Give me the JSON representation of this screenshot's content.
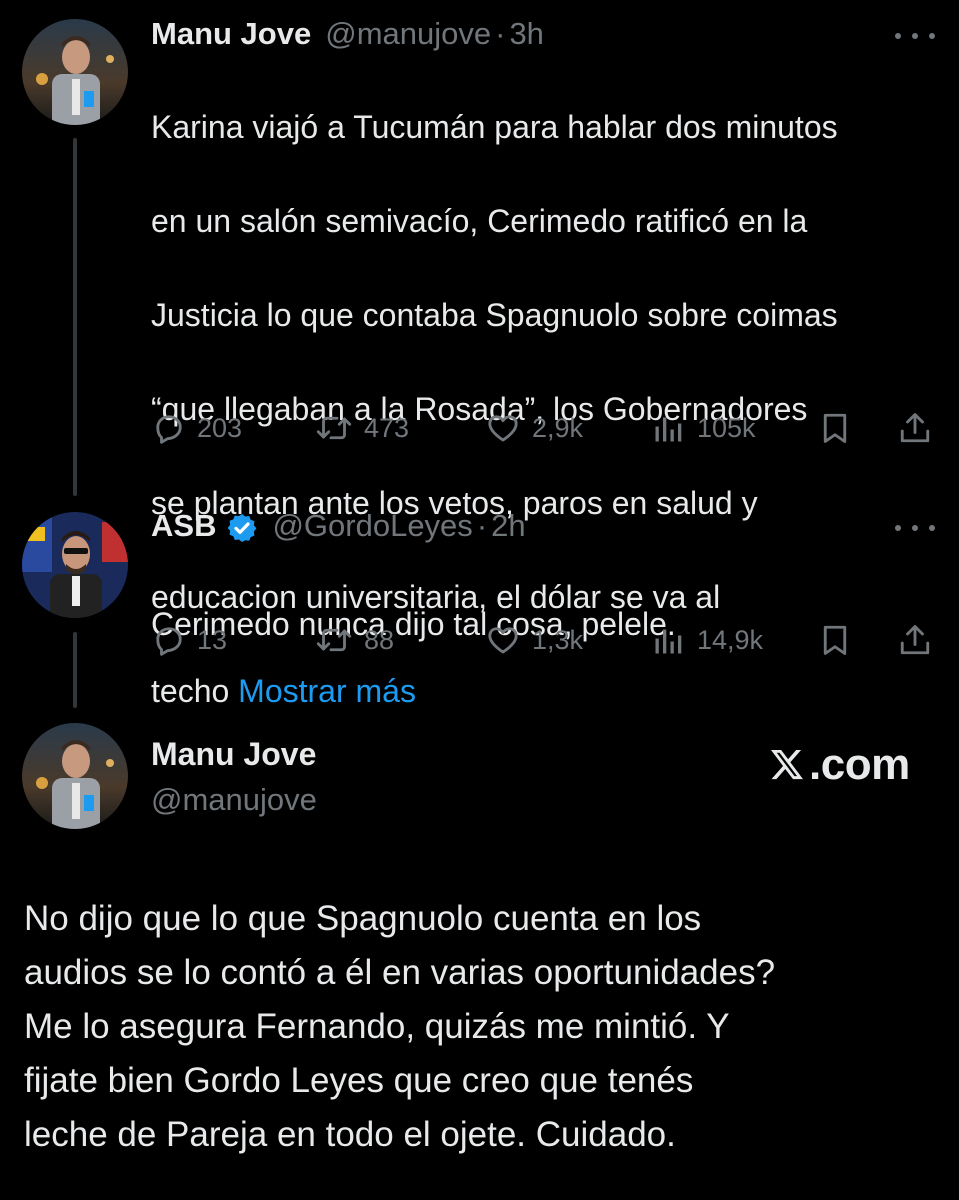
{
  "colors": {
    "background": "#000000",
    "text": "#e7e9ea",
    "muted": "#71767b",
    "link": "#1d9bf0",
    "verified_badge": "#1d9bf0"
  },
  "tweet1": {
    "name": "Manu Jove",
    "handle": "@manujove",
    "separator": "·",
    "time": "3h",
    "lines": [
      "Karina viajó a Tucumán para hablar dos minutos",
      "en un salón semivacío, Cerimedo ratificó en la",
      "Justicia lo que contaba Spagnuolo sobre coimas",
      "“que llegaban a la Rosada”, los Gobernadores",
      "se plantan ante los vetos, paros en salud y",
      "educacion universitaria, el dólar se va al"
    ],
    "last_line": "techo ",
    "show_more": "Mostrar más",
    "replies": "203",
    "retweets": "473",
    "likes": "2,9k",
    "views": "105k"
  },
  "tweet2": {
    "name": "ASB",
    "handle": "@GordoLeyes",
    "separator": "·",
    "time": "2h",
    "text": "Cerimedo nunca dijo tal cosa, pelele.",
    "replies": "13",
    "retweets": "88",
    "likes": "1,3k",
    "views": "14,9k"
  },
  "tweet3": {
    "name": "Manu Jove",
    "handle": "@manujove",
    "brand": ".com",
    "lines": [
      "No dijo que lo que Spagnuolo cuenta en los",
      "audios se lo contó a él en varias oportunidades?",
      "Me lo asegura Fernando, quizás me mintió. Y",
      "fijate bien Gordo Leyes que creo que tenés",
      "leche de Pareja en todo el ojete. Cuidado."
    ]
  },
  "icons": {
    "reply": "reply-icon",
    "retweet": "retweet-icon",
    "like": "heart-icon",
    "views": "views-icon",
    "bookmark": "bookmark-icon",
    "share": "share-icon",
    "more": "more-icon",
    "verified": "verified-badge-icon",
    "x_logo": "x-logo-icon"
  }
}
